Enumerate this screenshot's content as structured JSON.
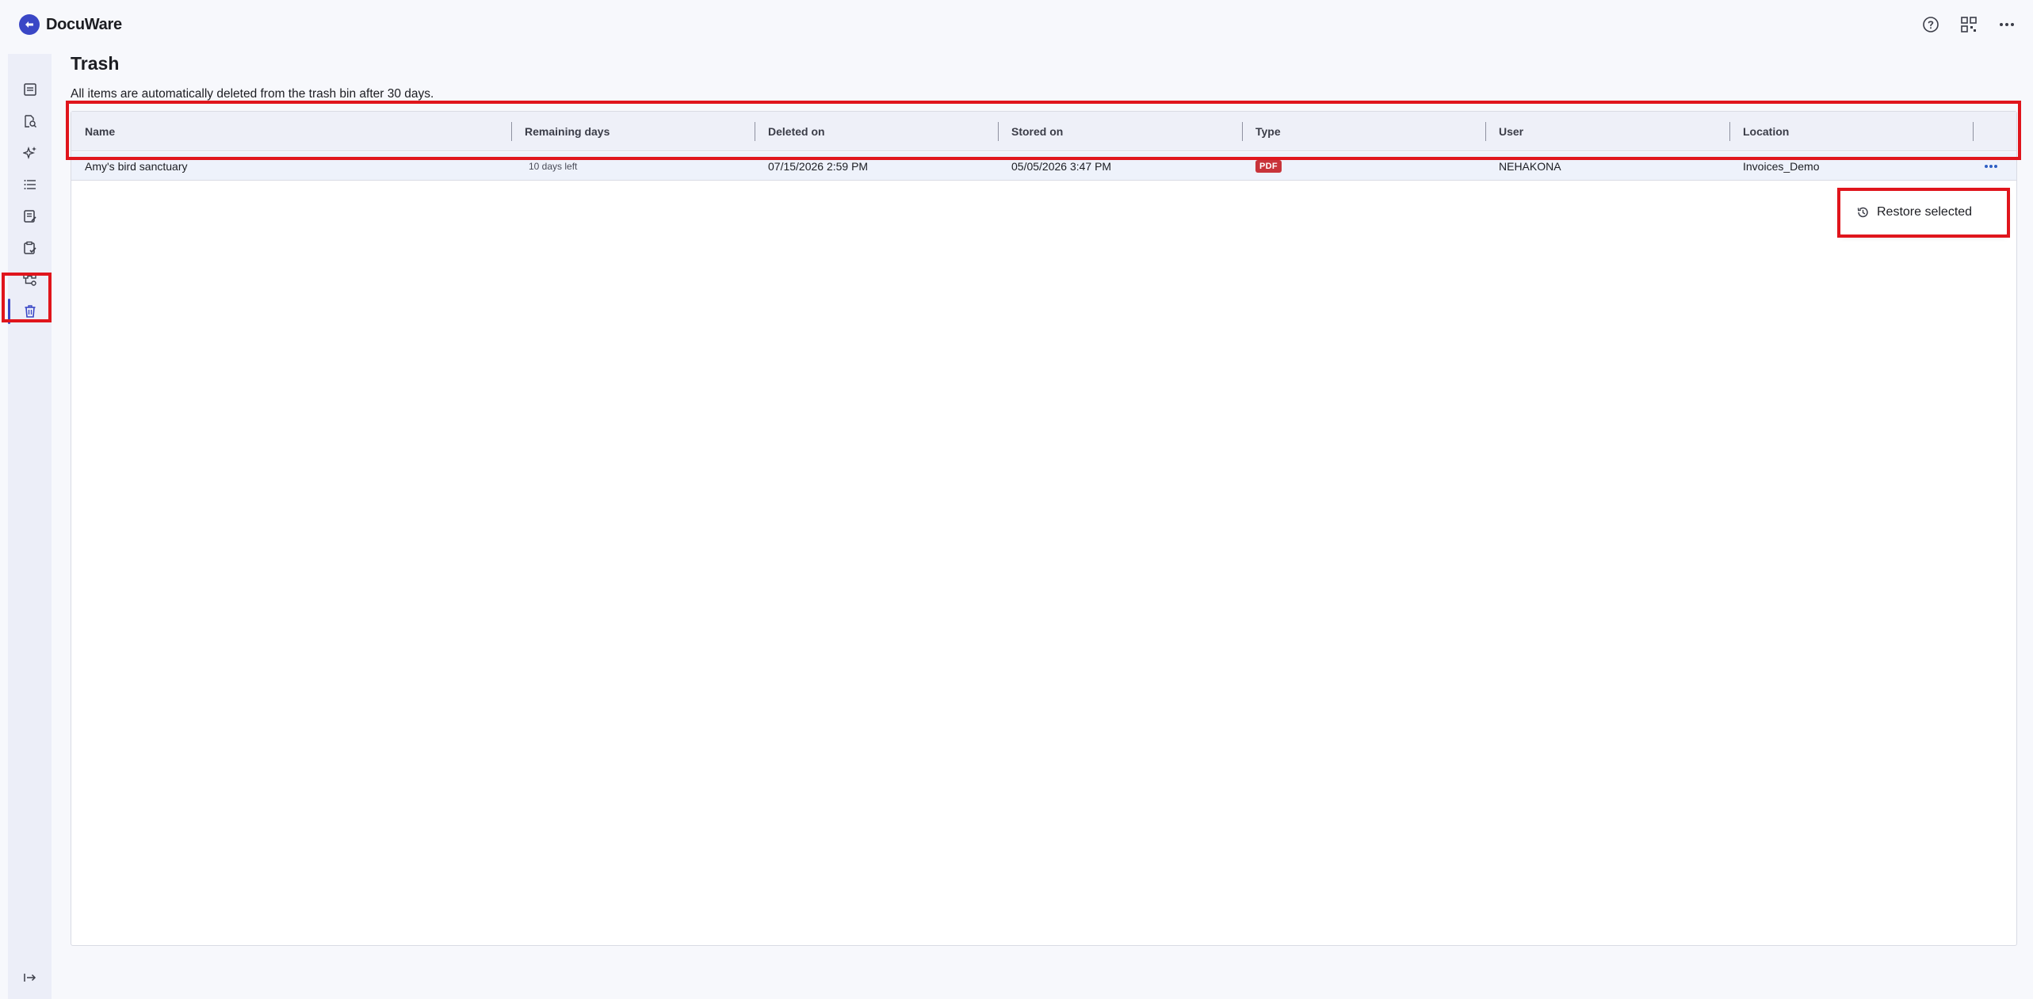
{
  "app": {
    "name": "DocuWare",
    "brand_color": "#3a47c6"
  },
  "topbar": {
    "actions": [
      "help-icon",
      "qr-code-icon",
      "more-icon"
    ]
  },
  "sidebar": {
    "items": [
      {
        "icon": "document-tray-icon"
      },
      {
        "icon": "document-search-icon"
      },
      {
        "icon": "ai-sparkle-icon"
      },
      {
        "icon": "list-icon"
      },
      {
        "icon": "form-icon"
      },
      {
        "icon": "clipboard-check-icon"
      },
      {
        "icon": "workflow-icon"
      },
      {
        "icon": "trash-icon",
        "active": true
      }
    ],
    "collapse_icon": "collapse-arrow-icon"
  },
  "page": {
    "title": "Trash",
    "description": "All items are automatically deleted from the trash bin after 30 days."
  },
  "table": {
    "columns": [
      "Name",
      "Remaining days",
      "Deleted on",
      "Stored on",
      "Type",
      "User",
      "Location"
    ],
    "rows": [
      {
        "name": "Amy's bird sanctuary",
        "remaining": "10 days left",
        "deleted_on": "07/15/2026 2:59 PM",
        "stored_on": "05/05/2026 3:47 PM",
        "type": "PDF",
        "user": "NEHAKONA",
        "location": "Invoices_Demo"
      }
    ]
  },
  "context_menu": {
    "restore_label": "Restore selected"
  },
  "colors": {
    "highlight": "#e0151c",
    "pdf_badge": "#c8343a"
  }
}
